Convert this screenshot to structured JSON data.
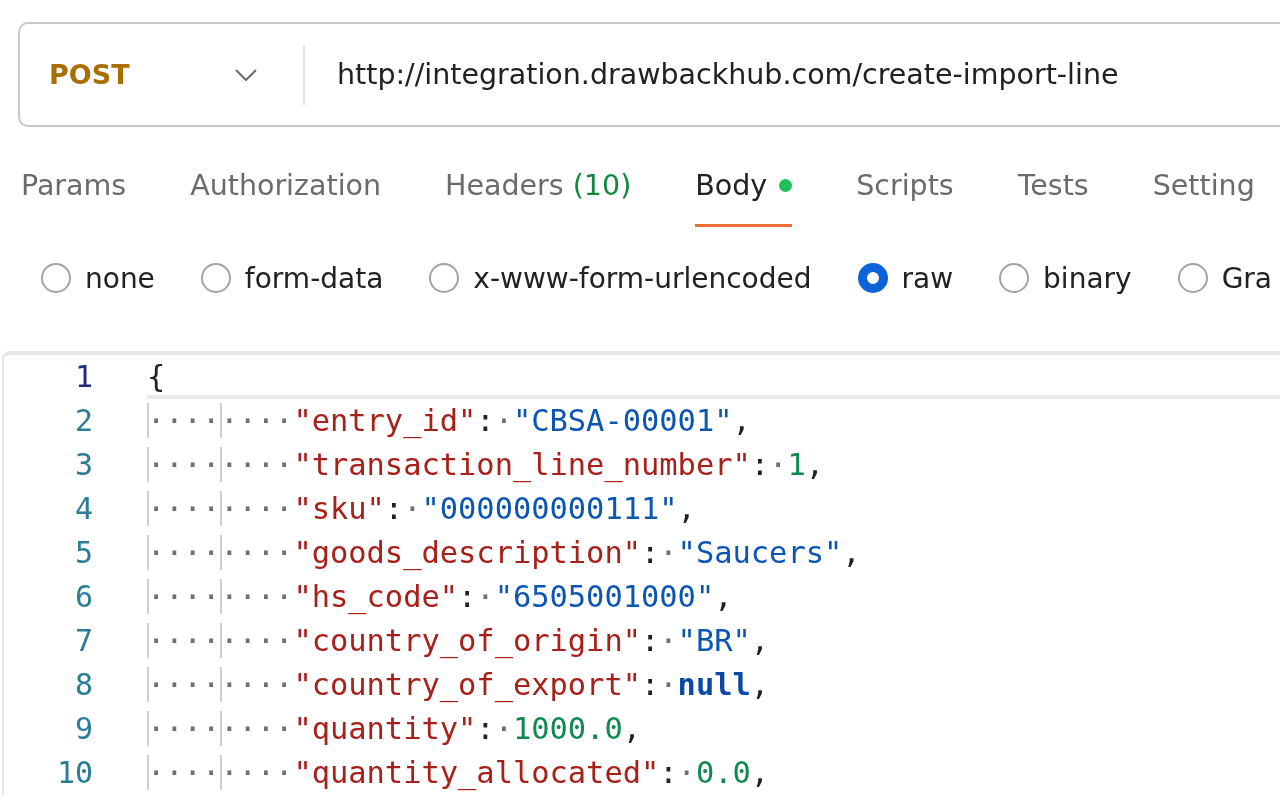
{
  "request": {
    "method": "POST",
    "url": "http://integration.drawbackhub.com/create-import-line"
  },
  "tabs": [
    {
      "label": "Params",
      "selected": false,
      "dot": false
    },
    {
      "label": "Authorization",
      "selected": false,
      "dot": false
    },
    {
      "label": "Headers",
      "count": "(10)",
      "selected": false,
      "dot": false
    },
    {
      "label": "Body",
      "selected": true,
      "dot": true
    },
    {
      "label": "Scripts",
      "selected": false,
      "dot": false
    },
    {
      "label": "Tests",
      "selected": false,
      "dot": false
    },
    {
      "label": "Setting",
      "selected": false,
      "dot": false
    }
  ],
  "body_types": [
    {
      "label": "none",
      "selected": false
    },
    {
      "label": "form-data",
      "selected": false
    },
    {
      "label": "x-www-form-urlencoded",
      "selected": false
    },
    {
      "label": "raw",
      "selected": true
    },
    {
      "label": "binary",
      "selected": false
    },
    {
      "label": "Gra",
      "selected": false
    }
  ],
  "editor": {
    "lines": [
      {
        "number": "1",
        "active": true,
        "tokens": [
          {
            "kind": "punct",
            "text": "{"
          }
        ]
      },
      {
        "number": "2",
        "active": false,
        "tokens": [
          {
            "kind": "ws",
            "text": "········"
          },
          {
            "kind": "key",
            "text": "\"entry_id\""
          },
          {
            "kind": "punct",
            "text": ":"
          },
          {
            "kind": "ws",
            "text": "·"
          },
          {
            "kind": "string",
            "text": "\"CBSA-00001\""
          },
          {
            "kind": "punct",
            "text": ","
          }
        ]
      },
      {
        "number": "3",
        "active": false,
        "tokens": [
          {
            "kind": "ws",
            "text": "········"
          },
          {
            "kind": "key",
            "text": "\"transaction_line_number\""
          },
          {
            "kind": "punct",
            "text": ":"
          },
          {
            "kind": "ws",
            "text": "·"
          },
          {
            "kind": "number",
            "text": "1"
          },
          {
            "kind": "punct",
            "text": ","
          }
        ]
      },
      {
        "number": "4",
        "active": false,
        "tokens": [
          {
            "kind": "ws",
            "text": "········"
          },
          {
            "kind": "key",
            "text": "\"sku\""
          },
          {
            "kind": "punct",
            "text": ":"
          },
          {
            "kind": "ws",
            "text": "·"
          },
          {
            "kind": "string",
            "text": "\"000000000111\""
          },
          {
            "kind": "punct",
            "text": ","
          }
        ]
      },
      {
        "number": "5",
        "active": false,
        "tokens": [
          {
            "kind": "ws",
            "text": "········"
          },
          {
            "kind": "key",
            "text": "\"goods_description\""
          },
          {
            "kind": "punct",
            "text": ":"
          },
          {
            "kind": "ws",
            "text": "·"
          },
          {
            "kind": "string",
            "text": "\"Saucers\""
          },
          {
            "kind": "punct",
            "text": ","
          }
        ]
      },
      {
        "number": "6",
        "active": false,
        "tokens": [
          {
            "kind": "ws",
            "text": "········"
          },
          {
            "kind": "key",
            "text": "\"hs_code\""
          },
          {
            "kind": "punct",
            "text": ":"
          },
          {
            "kind": "ws",
            "text": "·"
          },
          {
            "kind": "string",
            "text": "\"6505001000\""
          },
          {
            "kind": "punct",
            "text": ","
          }
        ]
      },
      {
        "number": "7",
        "active": false,
        "tokens": [
          {
            "kind": "ws",
            "text": "········"
          },
          {
            "kind": "key",
            "text": "\"country_of_origin\""
          },
          {
            "kind": "punct",
            "text": ":"
          },
          {
            "kind": "ws",
            "text": "·"
          },
          {
            "kind": "string",
            "text": "\"BR\""
          },
          {
            "kind": "punct",
            "text": ","
          }
        ]
      },
      {
        "number": "8",
        "active": false,
        "tokens": [
          {
            "kind": "ws",
            "text": "········"
          },
          {
            "kind": "key",
            "text": "\"country_of_export\""
          },
          {
            "kind": "punct",
            "text": ":"
          },
          {
            "kind": "ws",
            "text": "·"
          },
          {
            "kind": "keyword",
            "text": "null"
          },
          {
            "kind": "punct",
            "text": ","
          }
        ]
      },
      {
        "number": "9",
        "active": false,
        "tokens": [
          {
            "kind": "ws",
            "text": "········"
          },
          {
            "kind": "key",
            "text": "\"quantity\""
          },
          {
            "kind": "punct",
            "text": ":"
          },
          {
            "kind": "ws",
            "text": "·"
          },
          {
            "kind": "number",
            "text": "1000.0"
          },
          {
            "kind": "punct",
            "text": ","
          }
        ]
      },
      {
        "number": "10",
        "active": false,
        "tokens": [
          {
            "kind": "ws",
            "text": "········"
          },
          {
            "kind": "key",
            "text": "\"quantity_allocated\""
          },
          {
            "kind": "punct",
            "text": ":"
          },
          {
            "kind": "ws",
            "text": "·"
          },
          {
            "kind": "number",
            "text": "0.0"
          },
          {
            "kind": "punct",
            "text": ","
          }
        ]
      }
    ]
  }
}
